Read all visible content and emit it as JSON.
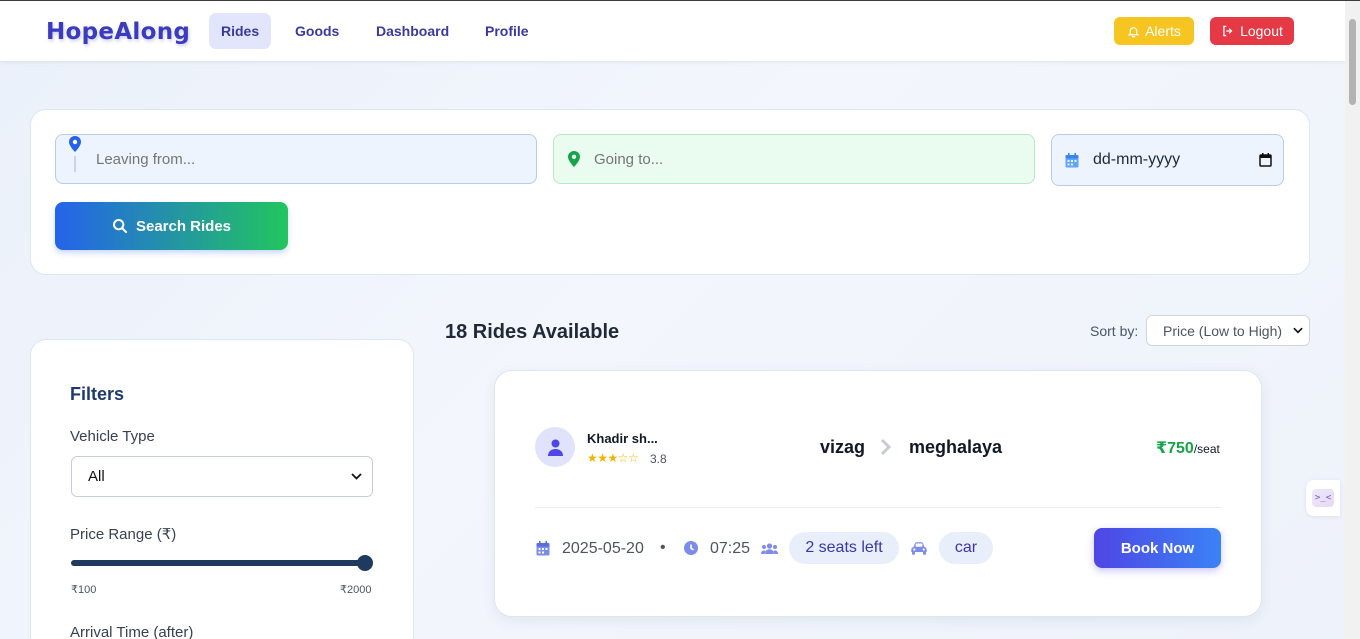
{
  "app": {
    "logo": "HopeAlong",
    "nav": [
      {
        "label": "Rides",
        "active": true
      },
      {
        "label": "Goods",
        "active": false
      },
      {
        "label": "Dashboard",
        "active": false
      },
      {
        "label": "Profile",
        "active": false
      }
    ],
    "alerts_label": "Alerts",
    "logout_label": "Logout"
  },
  "search": {
    "from_placeholder": "Leaving from...",
    "to_placeholder": "Going to...",
    "date_placeholder": "dd-mm-yyyy",
    "button_label": "Search Rides"
  },
  "filters": {
    "title": "Filters",
    "vehicle_type_label": "Vehicle Type",
    "vehicle_type_value": "All",
    "price_range_label": "Price Range (₹)",
    "price_min": "₹100",
    "price_max": "₹2000",
    "price_slider_value": 2000,
    "arrival_label": "Arrival Time (after)"
  },
  "results": {
    "count_label": "18 Rides Available",
    "sort_label": "Sort by:",
    "sort_value": "Price (Low to High)"
  },
  "ride": {
    "driver_name": "Khadir sh...",
    "stars": "★★★☆☆",
    "rating": "3.8",
    "from": "vizag",
    "to": "meghalaya",
    "price": "₹750",
    "per_seat": "/seat",
    "date": "2025-05-20",
    "dot": "•",
    "time": "07:25",
    "seats": "2 seats left",
    "vehicle": "car",
    "book_label": "Book Now"
  },
  "widget": {
    "glyph": ">_<"
  },
  "colors": {
    "brand": "#3b3bbf",
    "alerts": "#f6c521",
    "logout": "#e53945",
    "price": "#16a34a",
    "book_start": "#4f46e5",
    "book_end": "#3b82f6"
  },
  "icons": {
    "alerts": "bell-icon",
    "logout": "logout-icon",
    "from": "map-pin-icon",
    "to": "location-dot-icon",
    "date": "calendar-icon",
    "search": "search-icon",
    "avatar": "user-icon",
    "route": "chevron-right-icon",
    "meta_date": "calendar-icon",
    "meta_time": "clock-icon",
    "seats": "users-icon",
    "vehicle": "car-icon"
  }
}
